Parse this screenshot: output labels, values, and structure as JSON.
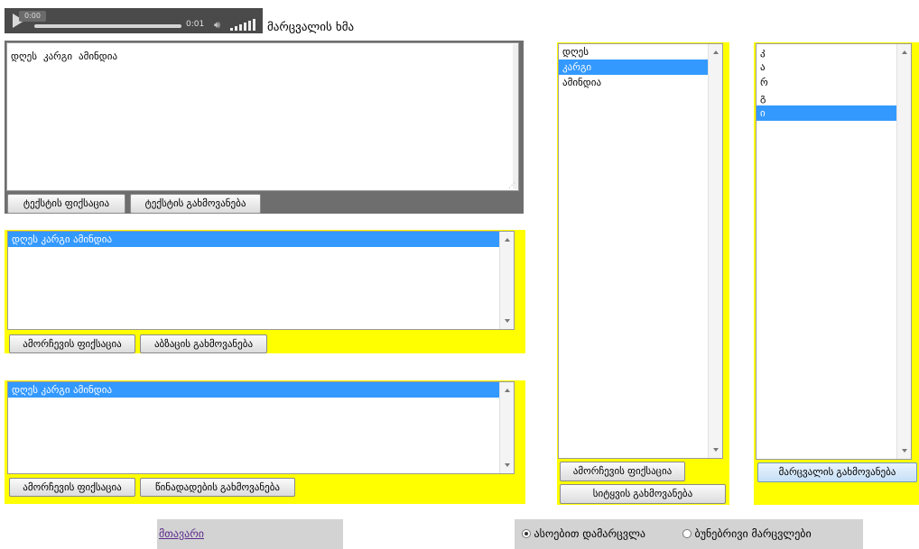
{
  "player": {
    "time_bubble": "0:00",
    "current_time": "0:01",
    "progress": 0.0,
    "label": "მარცვალის ხმა"
  },
  "text_panel": {
    "text": "დღეს  კარგი  ამინდია",
    "fix_button": "ტექსტის ფიქსაცია",
    "extract_button": "ტექსტის გახმოვანება"
  },
  "paragraph_panel": {
    "items": [
      {
        "label": "დღეს კარგი ამინდია",
        "selected": true
      }
    ],
    "fix_button": "ამორჩევის ფიქსაცია",
    "extract_button": "აბზაცის გახმოვანება"
  },
  "sentence_panel": {
    "items": [
      {
        "label": "დღეს კარგი ამინდია",
        "selected": true
      }
    ],
    "fix_button": "ამორჩევის ფიქსაცია",
    "extract_button": "წინადადების გახმოვანება"
  },
  "word_panel": {
    "items": [
      {
        "label": "დღეს",
        "selected": false
      },
      {
        "label": "კარგი",
        "selected": true
      },
      {
        "label": "ამინდია",
        "selected": false
      }
    ],
    "fix_button": "ამორჩევის ფიქსაცია",
    "extract_button": "სიტყვის გახმოვანება"
  },
  "syllable_panel": {
    "items": [
      {
        "label": "კ",
        "selected": false
      },
      {
        "label": "ა",
        "selected": false
      },
      {
        "label": "რ",
        "selected": false
      },
      {
        "label": "გ",
        "selected": false
      },
      {
        "label": "ი",
        "selected": true
      }
    ],
    "extract_button": "მარცვალის გახმოვანება"
  },
  "footer": {
    "home_link": "მთავარი",
    "radio_options": [
      {
        "label": "ასოებით დამარცვლა",
        "checked": true
      },
      {
        "label": "ბუნებრივი მარცვლები",
        "checked": false
      }
    ]
  },
  "colors": {
    "panel_yellow": "#ffff00",
    "selection_blue": "#3399ff",
    "player_dark": "#4a4a4a"
  }
}
